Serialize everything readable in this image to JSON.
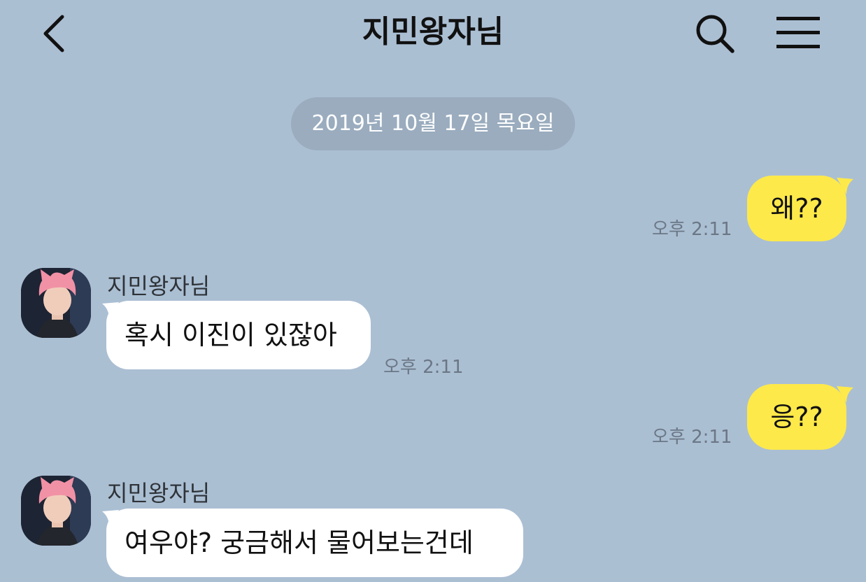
{
  "header": {
    "title": "지민왕자님",
    "back_icon": "chevron-left-icon",
    "search_icon": "search-icon",
    "menu_icon": "menu-icon"
  },
  "date_divider": "2019년 10월 17일 목요일",
  "colors": {
    "background": "#abbfd3",
    "my_bubble": "#fee94a",
    "their_bubble": "#ffffff",
    "date_pill": "#9aacbe"
  },
  "messages": [
    {
      "from": "me",
      "text": "왜??",
      "time": "오후 2:11"
    },
    {
      "from": "them",
      "sender": "지민왕자님",
      "text": "혹시 이진이 있잖아",
      "time": "오후 2:11"
    },
    {
      "from": "me",
      "text": "응??",
      "time": "오후 2:11"
    },
    {
      "from": "them",
      "sender": "지민왕자님",
      "text": "여우야? 궁금해서 물어보는건데"
    }
  ]
}
